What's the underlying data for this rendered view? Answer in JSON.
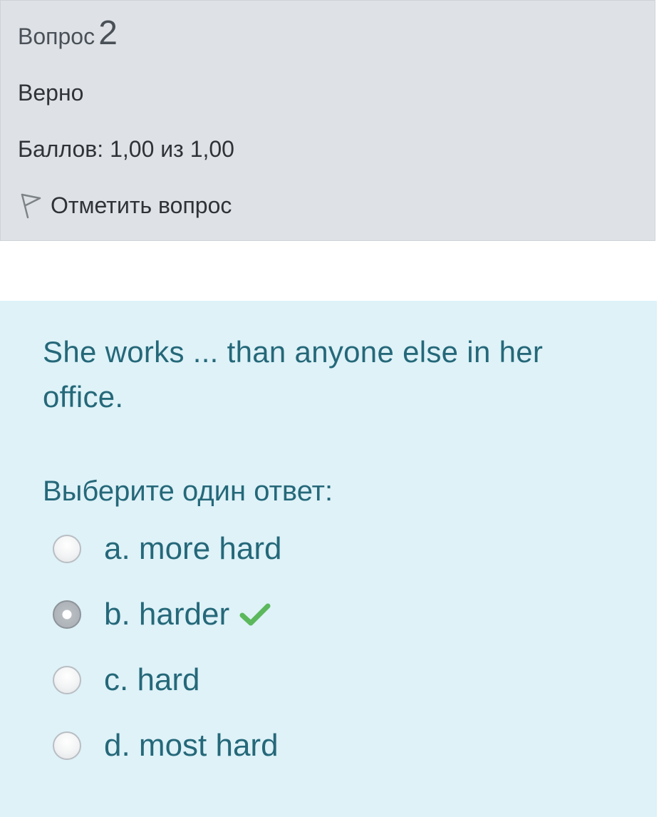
{
  "info": {
    "question_word": "Вопрос",
    "question_number": "2",
    "state": "Верно",
    "grade": "Баллов: 1,00 из 1,00",
    "flag_label": "Отметить вопрос",
    "flag_icon": "flag-icon"
  },
  "question": {
    "text": "She works ... than anyone else in her office.",
    "prompt": "Выберите один ответ:",
    "options": [
      {
        "label": "a. more hard",
        "selected": false
      },
      {
        "label": "b. harder",
        "selected": true,
        "correct_icon": "check-icon"
      },
      {
        "label": "c. hard",
        "selected": false
      },
      {
        "label": "d. most hard",
        "selected": false
      }
    ]
  },
  "colors": {
    "info_background": "#dee2e6",
    "content_background": "#def2f8",
    "question_text": "#256879",
    "correct_check": "#5cb85c"
  }
}
